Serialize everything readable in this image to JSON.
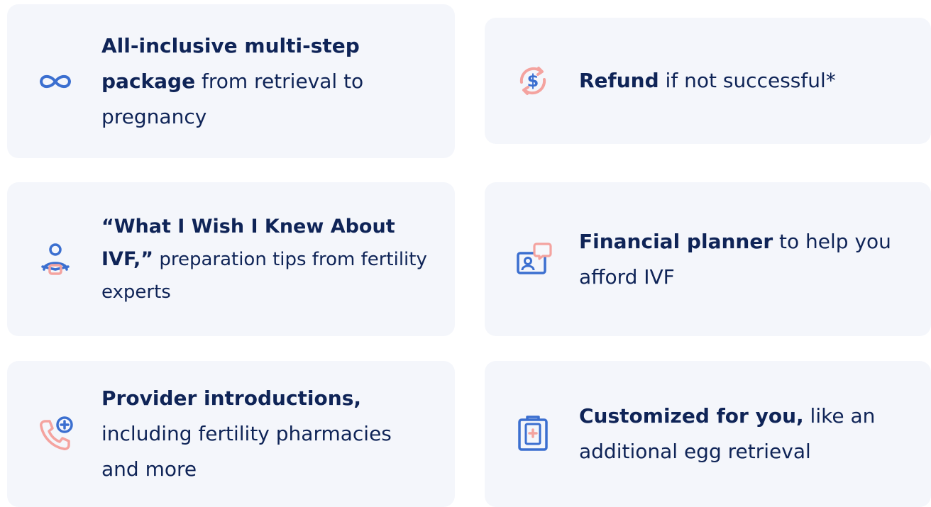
{
  "cards": [
    {
      "icon": "infinity-icon",
      "bold": "All-inclusive multi-step package",
      "rest": " from retrieval to pregnancy"
    },
    {
      "icon": "refund-dollar-icon",
      "bold": "Refund",
      "rest": " if not successful*"
    },
    {
      "icon": "person-reading-icon",
      "bold": "“What I Wish I Knew About IVF,”",
      "rest": " preparation tips from fertility experts"
    },
    {
      "icon": "financial-planner-icon",
      "bold": "Financial planner",
      "rest": " to help you afford IVF"
    },
    {
      "icon": "phone-add-icon",
      "bold": "Provider introductions,",
      "rest": " including fertility pharmacies and more"
    },
    {
      "icon": "medical-clipboard-icon",
      "bold": "Customized for you,",
      "rest": " like an additional egg retrieval"
    }
  ],
  "colors": {
    "card_bg": "#f4f6fb",
    "text": "#0f2457",
    "icon_blue": "#3b6fd0",
    "icon_pink": "#f4a39f"
  }
}
